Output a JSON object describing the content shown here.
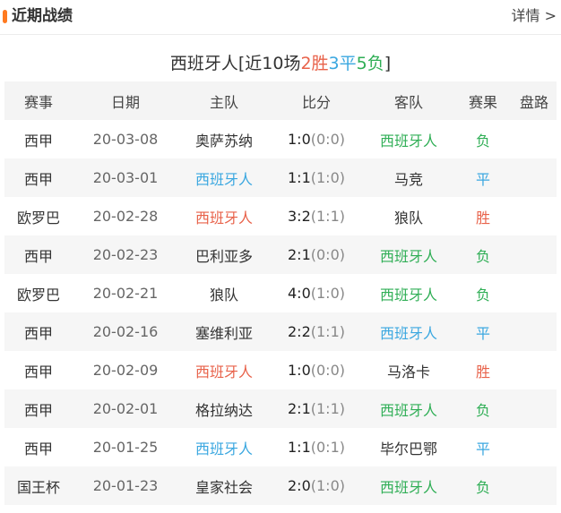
{
  "header": {
    "title": "近期战绩",
    "more": "详情 >"
  },
  "summary": {
    "team": "西班牙人",
    "open": "[近10场",
    "win": "2胜",
    "draw": "3平",
    "lose": "5负",
    "close": "]"
  },
  "columns": [
    "赛事",
    "日期",
    "主队",
    "比分",
    "客队",
    "赛果",
    "盘路"
  ],
  "colors": {
    "win": "#e8624a",
    "draw": "#3aa7e0",
    "lose": "#2fae55",
    "accent_bar": "#ff7a20"
  },
  "rows": [
    {
      "league": "西甲",
      "date": "20-03-08",
      "home": "奥萨苏纳",
      "score": "1:0",
      "half": "(0:0)",
      "away": "西班牙人",
      "result": "负",
      "handicap": "",
      "highlight": "away",
      "status": "lose"
    },
    {
      "league": "西甲",
      "date": "20-03-01",
      "home": "西班牙人",
      "score": "1:1",
      "half": "(1:0)",
      "away": "马竞",
      "result": "平",
      "handicap": "",
      "highlight": "home",
      "status": "draw"
    },
    {
      "league": "欧罗巴",
      "date": "20-02-28",
      "home": "西班牙人",
      "score": "3:2",
      "half": "(1:1)",
      "away": "狼队",
      "result": "胜",
      "handicap": "",
      "highlight": "home",
      "status": "win"
    },
    {
      "league": "西甲",
      "date": "20-02-23",
      "home": "巴利亚多",
      "score": "2:1",
      "half": "(0:0)",
      "away": "西班牙人",
      "result": "负",
      "handicap": "",
      "highlight": "away",
      "status": "lose"
    },
    {
      "league": "欧罗巴",
      "date": "20-02-21",
      "home": "狼队",
      "score": "4:0",
      "half": "(1:0)",
      "away": "西班牙人",
      "result": "负",
      "handicap": "",
      "highlight": "away",
      "status": "lose"
    },
    {
      "league": "西甲",
      "date": "20-02-16",
      "home": "塞维利亚",
      "score": "2:2",
      "half": "(1:1)",
      "away": "西班牙人",
      "result": "平",
      "handicap": "",
      "highlight": "away",
      "status": "draw"
    },
    {
      "league": "西甲",
      "date": "20-02-09",
      "home": "西班牙人",
      "score": "1:0",
      "half": "(0:0)",
      "away": "马洛卡",
      "result": "胜",
      "handicap": "",
      "highlight": "home",
      "status": "win"
    },
    {
      "league": "西甲",
      "date": "20-02-01",
      "home": "格拉纳达",
      "score": "2:1",
      "half": "(1:1)",
      "away": "西班牙人",
      "result": "负",
      "handicap": "",
      "highlight": "away",
      "status": "lose"
    },
    {
      "league": "西甲",
      "date": "20-01-25",
      "home": "西班牙人",
      "score": "1:1",
      "half": "(0:1)",
      "away": "毕尔巴鄂",
      "result": "平",
      "handicap": "",
      "highlight": "home",
      "status": "draw"
    },
    {
      "league": "国王杯",
      "date": "20-01-23",
      "home": "皇家社会",
      "score": "2:0",
      "half": "(1:0)",
      "away": "西班牙人",
      "result": "负",
      "handicap": "",
      "highlight": "away",
      "status": "lose"
    }
  ]
}
